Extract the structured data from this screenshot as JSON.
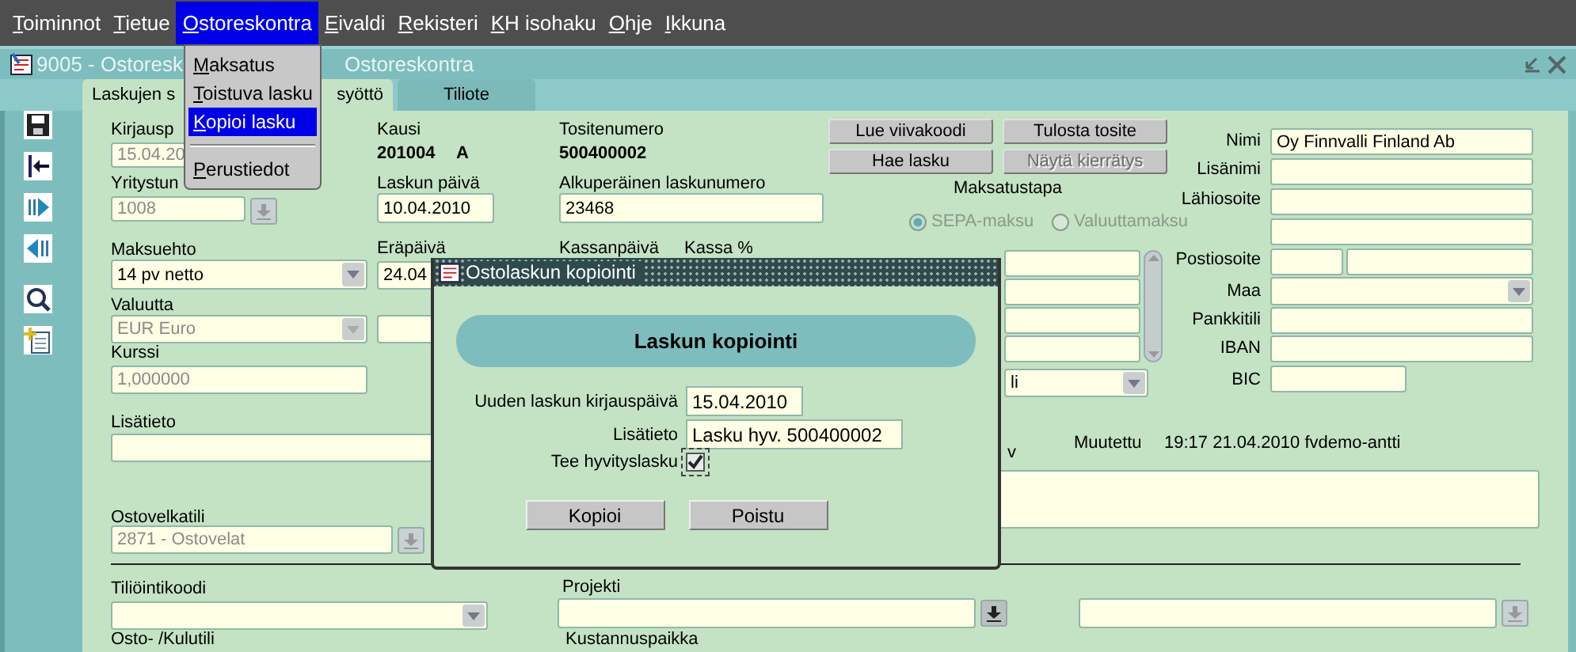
{
  "menubar": [
    {
      "label": "Toiminnot",
      "selected": false
    },
    {
      "label": "Tietue",
      "selected": false
    },
    {
      "label": "Ostoreskontra",
      "selected": true
    },
    {
      "label": "Eivaldi",
      "selected": false
    },
    {
      "label": "Rekisteri",
      "selected": false
    },
    {
      "label": "KH isohaku",
      "selected": false
    },
    {
      "label": "Ohje",
      "selected": false
    },
    {
      "label": "Ikkuna",
      "selected": false
    }
  ],
  "menu": {
    "items": [
      {
        "kind": "item",
        "label": "Maksatus",
        "selected": false
      },
      {
        "kind": "item",
        "label": "Toistuva lasku",
        "selected": false
      },
      {
        "kind": "item",
        "label": "Kopioi lasku",
        "selected": true
      },
      {
        "kind": "separator"
      },
      {
        "kind": "item",
        "label": "Perustiedot",
        "selected": false
      }
    ]
  },
  "window": {
    "title_parts": [
      "9005 - Ostoresk",
      "Ostoreskontra"
    ]
  },
  "tabs": [
    {
      "label_parts": [
        "Laskujen s",
        "syöttö"
      ],
      "selected": true
    },
    {
      "label_parts": [
        "Tiliote"
      ],
      "selected": false
    }
  ],
  "form": {
    "items": [
      {
        "kind": "label",
        "text": "Kirjausp"
      },
      {
        "kind": "field",
        "value": "15.04.20",
        "disabled": true
      },
      {
        "kind": "label",
        "text": "Yritystun"
      },
      {
        "kind": "lov",
        "value": "1008",
        "disabled": true
      },
      {
        "kind": "label",
        "text": "Kausi"
      },
      {
        "kind": "value",
        "text": "201004"
      },
      {
        "kind": "value",
        "text": "A"
      },
      {
        "kind": "label",
        "text": "Laskun päivä"
      },
      {
        "kind": "field",
        "value": "10.04.2010",
        "disabled": false
      },
      {
        "kind": "label",
        "text": "Tositenumero"
      },
      {
        "kind": "value",
        "text": "500400002"
      },
      {
        "kind": "label",
        "text": "Alkuperäinen laskunumero"
      },
      {
        "kind": "field",
        "value": "23468",
        "disabled": false
      },
      {
        "kind": "button",
        "label": "Lue viivakoodi",
        "disabled": false
      },
      {
        "kind": "button",
        "label": "Tulosta tosite",
        "disabled": false
      },
      {
        "kind": "button",
        "label": "Hae lasku",
        "disabled": false
      },
      {
        "kind": "button",
        "label": "Näytä kierrätys",
        "disabled": true
      },
      {
        "kind": "label",
        "text": "Maksatustapa"
      },
      {
        "kind": "radio",
        "label": "SEPA-maksu",
        "selected": true,
        "disabled": true
      },
      {
        "kind": "radio",
        "label": "Valuuttamaksu",
        "selected": false,
        "disabled": true
      },
      {
        "kind": "field"
      },
      {
        "kind": "field"
      },
      {
        "kind": "field"
      },
      {
        "kind": "field"
      },
      {
        "kind": "scrollbar"
      },
      {
        "kind": "dropdown",
        "value": "li",
        "disabled": false
      },
      {
        "kind": "label",
        "text": "Nimi"
      },
      {
        "kind": "field",
        "value": "Oy Finnvalli Finland Ab",
        "disabled": false
      },
      {
        "kind": "label",
        "text": "Lisänimi"
      },
      {
        "kind": "field"
      },
      {
        "kind": "label",
        "text": "Lähiosoite"
      },
      {
        "kind": "field"
      },
      {
        "kind": "field"
      },
      {
        "kind": "label",
        "text": "Postiosoite"
      },
      {
        "kind": "field"
      },
      {
        "kind": "field"
      },
      {
        "kind": "label",
        "text": "Maa"
      },
      {
        "kind": "dropdown"
      },
      {
        "kind": "label",
        "text": "Pankkitili"
      },
      {
        "kind": "field"
      },
      {
        "kind": "label",
        "text": "IBAN"
      },
      {
        "kind": "field"
      },
      {
        "kind": "label",
        "text": "BIC"
      },
      {
        "kind": "field"
      },
      {
        "kind": "label",
        "text": "Maksuehto"
      },
      {
        "kind": "dropdown",
        "value": "14 pv netto",
        "disabled": false
      },
      {
        "kind": "label",
        "text": "Eräpäivä"
      },
      {
        "kind": "field",
        "value": "24.04",
        "disabled": false
      },
      {
        "kind": "label",
        "text": "Kassanpäivä"
      },
      {
        "kind": "label",
        "text": "Kassa %"
      },
      {
        "kind": "label",
        "text": "Valuutta"
      },
      {
        "kind": "dropdown",
        "value": "EUR Euro",
        "disabled": true
      },
      {
        "kind": "field"
      },
      {
        "kind": "label",
        "text": "Kurssi"
      },
      {
        "kind": "field",
        "value": "1,000000",
        "disabled": true
      },
      {
        "kind": "label",
        "text": "Lisätieto"
      },
      {
        "kind": "field"
      },
      {
        "kind": "label",
        "text": "v"
      },
      {
        "kind": "label",
        "text": "Muutettu"
      },
      {
        "kind": "text",
        "text": "19:17 21.04.2010 fvdemo-antti"
      },
      {
        "kind": "field"
      },
      {
        "kind": "label",
        "text": "Ostovelkatili"
      },
      {
        "kind": "lov",
        "value": "2871 - Ostovelat",
        "disabled": true
      },
      {
        "kind": "rule"
      },
      {
        "kind": "label",
        "text": "Tiliöintikoodi"
      },
      {
        "kind": "dropdown"
      },
      {
        "kind": "label",
        "text": "Projekti"
      },
      {
        "kind": "lov",
        "disabled": false
      },
      {
        "kind": "lov",
        "disabled": true
      },
      {
        "kind": "label",
        "text": "Osto- /Kulutili"
      },
      {
        "kind": "label",
        "text": "Kustannuspaikka"
      }
    ]
  },
  "dialog": {
    "title": "Ostolaskun kopiointi",
    "heading": "Laskun kopiointi",
    "rows": [
      {
        "label": "Uuden laskun kirjauspäivä",
        "value": "15.04.2010"
      },
      {
        "label": "Lisätieto",
        "value": "Lasku hyv. 500400002"
      }
    ],
    "checkbox": {
      "label": "Tee hyvityslasku",
      "checked": true
    },
    "buttons": [
      "Kopioi",
      "Poistu"
    ]
  }
}
